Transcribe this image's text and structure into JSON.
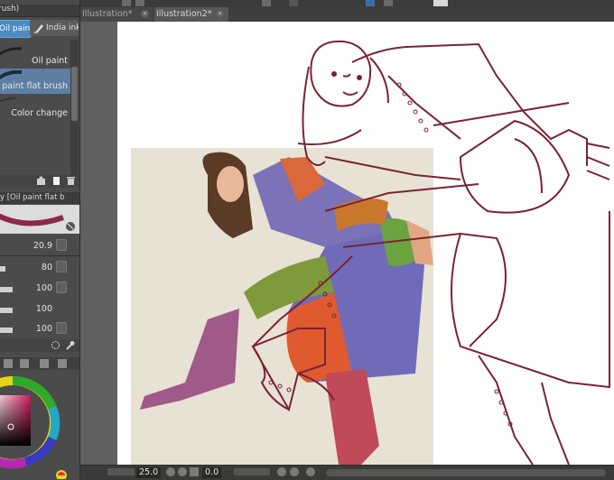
{
  "brush_panel": {
    "header_text": "rush)",
    "tabs": [
      {
        "label": "Oil paint",
        "selected": true
      },
      {
        "label": "India ink",
        "selected": false
      }
    ],
    "items": [
      {
        "label": "Oil paint",
        "selected": false
      },
      {
        "label": "Oil paint flat brush",
        "selected": true
      },
      {
        "label": "Color change",
        "selected": false
      }
    ]
  },
  "tool_property": {
    "header": "y [Oil paint flat b",
    "rows": [
      {
        "value": "20.9"
      },
      {
        "value": "80"
      },
      {
        "value": "100"
      },
      {
        "value": "100"
      },
      {
        "value": "100"
      }
    ]
  },
  "documents": {
    "tabs": [
      {
        "label": "Illustration*",
        "active": false
      },
      {
        "label": "Illustration2*",
        "active": true
      }
    ]
  },
  "status_bar": {
    "zoom": "25.0",
    "rotation": "0.0"
  },
  "color_wheel": {
    "hue_color": "#d01b5e"
  },
  "colors": {
    "accent": "#4d8ac2",
    "line_art": "#7a2333"
  },
  "icons": {
    "close": "close-icon",
    "pen": "pen-icon",
    "search": "magnifier-icon"
  }
}
